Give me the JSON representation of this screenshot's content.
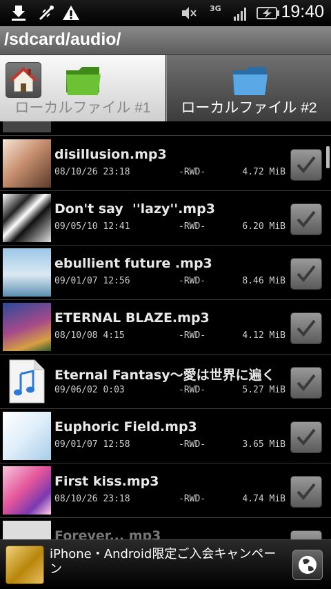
{
  "status_bar": {
    "time": "19:40",
    "network": "3G",
    "icons": [
      "download-complete-icon",
      "usb-debug-icon",
      "warning-icon",
      "mute-icon",
      "signal-icon",
      "battery-charging-icon"
    ]
  },
  "path_bar": {
    "path": "/sdcard/audio/"
  },
  "tabs": [
    {
      "label": "ローカルファイル #1",
      "selected": false
    },
    {
      "label": "ローカルファイル #2",
      "selected": true
    }
  ],
  "files": [
    {
      "name": "disillusion.mp3",
      "date": "08/10/26 23:18",
      "perm": "-RWD-",
      "size": "4.72 MiB",
      "checked": true
    },
    {
      "name": "Don't say  ''lazy''.mp3",
      "date": "09/05/10 12:41",
      "perm": "-RWD-",
      "size": "6.20 MiB",
      "checked": true
    },
    {
      "name": "ebullient future .mp3",
      "date": "09/01/07 12:56",
      "perm": "-RWD-",
      "size": "8.46 MiB",
      "checked": true
    },
    {
      "name": "ETERNAL BLAZE.mp3",
      "date": "08/10/08 4:15",
      "perm": "-RWD-",
      "size": "4.12 MiB",
      "checked": true
    },
    {
      "name": "Eternal Fantasy～愛は世界に遍く",
      "date": "09/06/02 0:03",
      "perm": "-RWD-",
      "size": "5.27 MiB",
      "checked": true
    },
    {
      "name": "Euphoric Field.mp3",
      "date": "09/01/07 12:58",
      "perm": "-RWD-",
      "size": "3.65 MiB",
      "checked": true
    },
    {
      "name": "First kiss.mp3",
      "date": "08/10/26 23:18",
      "perm": "-RWD-",
      "size": "4.74 MiB",
      "checked": true
    },
    {
      "name": "Forever... mp3",
      "date": "",
      "perm": "",
      "size": "",
      "checked": true
    }
  ],
  "ad": {
    "text": "iPhone・Android限定ご入会キャンペーン"
  },
  "colors": {
    "accent_folder_green": "#5fae2a",
    "accent_folder_blue": "#3f8fd0",
    "background": "#000000"
  }
}
